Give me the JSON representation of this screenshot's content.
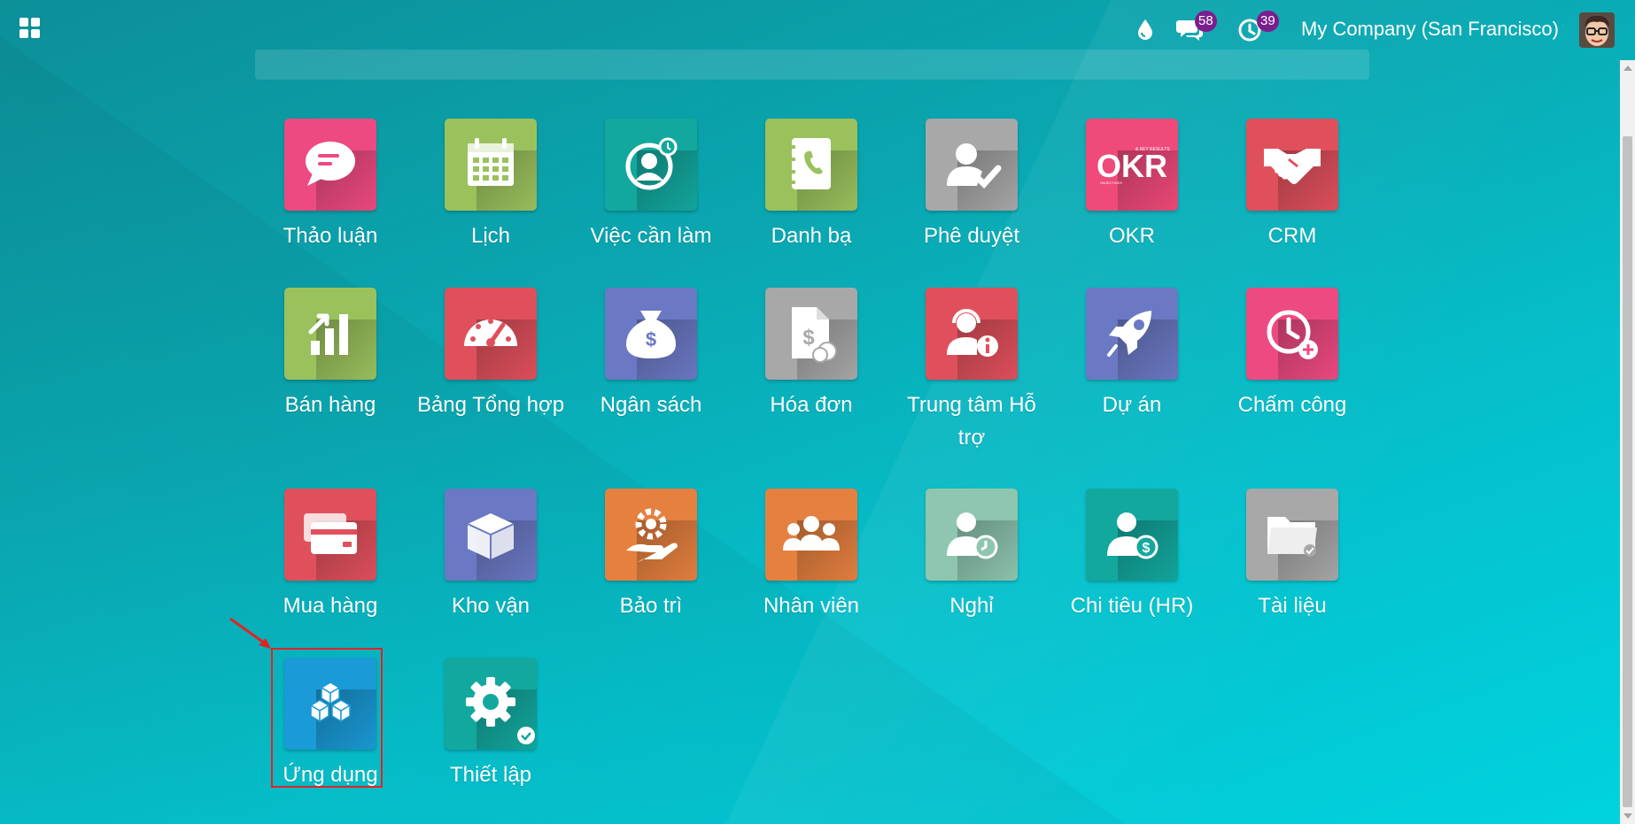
{
  "topbar": {
    "company": "My Company (San Francisco)",
    "messages_count": "58",
    "activities_count": "39"
  },
  "apps": [
    {
      "label": "Thảo luận",
      "color": "#ee4a82",
      "icon": "chat-icon"
    },
    {
      "label": "Lịch",
      "color": "#9bc15d",
      "icon": "calendar-icon"
    },
    {
      "label": "Việc cần làm",
      "color": "#13a89e",
      "icon": "todo-icon"
    },
    {
      "label": "Danh bạ",
      "color": "#9bc15d",
      "icon": "contacts-icon"
    },
    {
      "label": "Phê duyệt",
      "color": "#a8a8a8",
      "icon": "approval-icon"
    },
    {
      "label": "OKR",
      "color": "#ef4a7a",
      "icon": "okr-icon"
    },
    {
      "label": "CRM",
      "color": "#e0505c",
      "icon": "handshake-icon"
    },
    {
      "label": "Bán hàng",
      "color": "#9bc15d",
      "icon": "sales-icon"
    },
    {
      "label": "Bảng Tổng hợp",
      "color": "#e0505c",
      "icon": "dashboard-icon"
    },
    {
      "label": "Ngân sách",
      "color": "#6b79c4",
      "icon": "budget-icon"
    },
    {
      "label": "Hóa đơn",
      "color": "#a8a8a8",
      "icon": "invoice-icon"
    },
    {
      "label": "Trung tâm Hỗ trợ",
      "color": "#e0505c",
      "icon": "helpdesk-icon"
    },
    {
      "label": "Dự án",
      "color": "#6b79c4",
      "icon": "rocket-icon"
    },
    {
      "label": "Chấm công",
      "color": "#ee4a82",
      "icon": "timesheet-icon"
    },
    {
      "label": "Mua hàng",
      "color": "#e0505c",
      "icon": "credit-card-icon"
    },
    {
      "label": "Kho vận",
      "color": "#6b79c4",
      "icon": "box-icon"
    },
    {
      "label": "Bảo trì",
      "color": "#e5803f",
      "icon": "maintenance-icon"
    },
    {
      "label": "Nhân viên",
      "color": "#e5803f",
      "icon": "employees-icon"
    },
    {
      "label": "Nghỉ",
      "color": "#8ec6b0",
      "icon": "time-off-icon"
    },
    {
      "label": "Chi tiêu (HR)",
      "color": "#13a89e",
      "icon": "expenses-icon"
    },
    {
      "label": "Tài liệu",
      "color": "#a8a8a8",
      "icon": "folder-icon"
    },
    {
      "label": "Ứng dụng",
      "color": "#1a9ad6",
      "icon": "cubes-icon"
    },
    {
      "label": "Thiết lập",
      "color": "#13a89e",
      "icon": "gear-icon"
    }
  ]
}
